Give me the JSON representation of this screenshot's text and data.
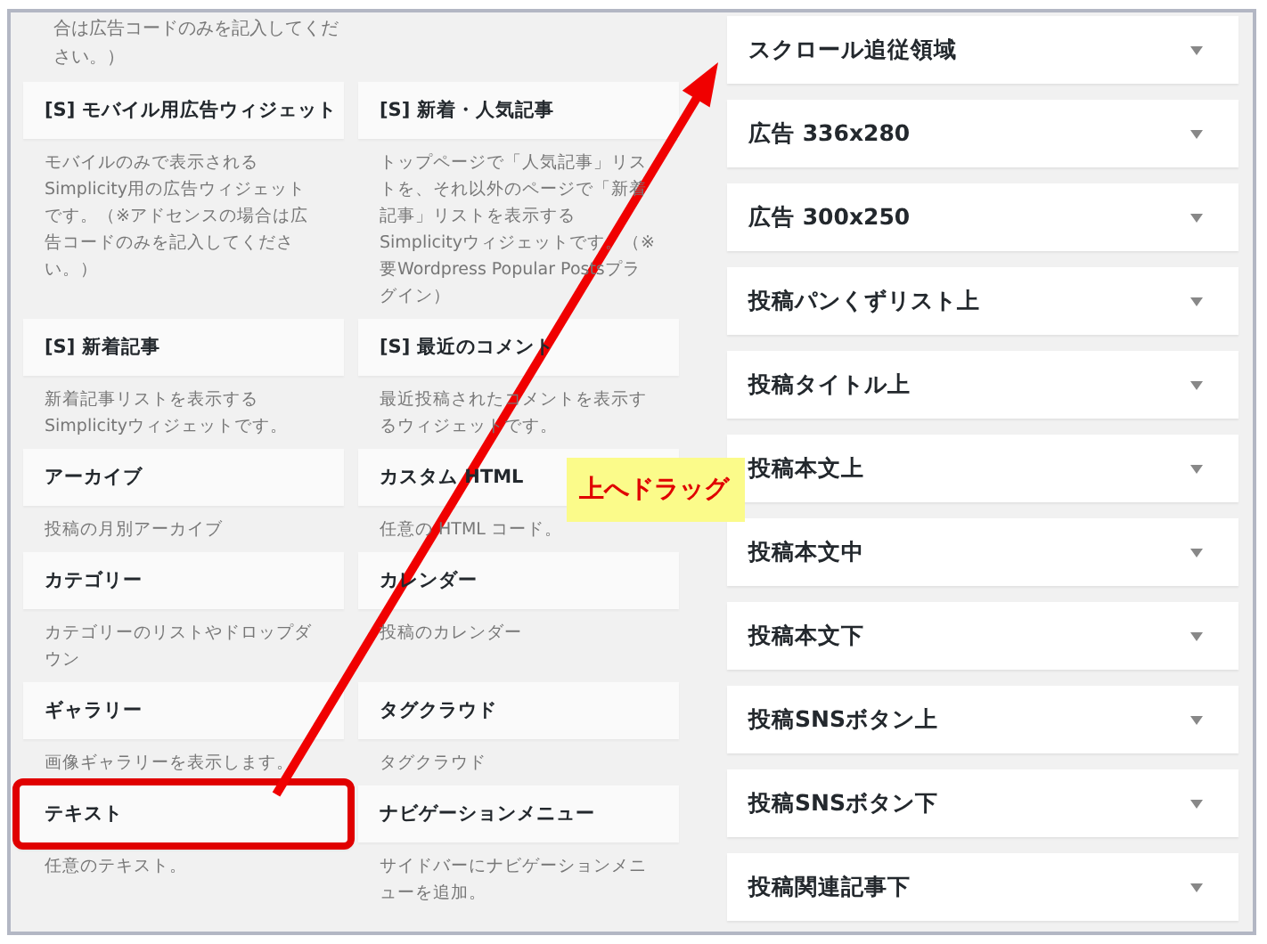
{
  "available_widgets": {
    "top_description": "合は広告コードのみを記入してください。）",
    "widgets": [
      {
        "title": "[S] モバイル用広告ウィジェット",
        "description": "モバイルのみで表示されるSimplicity用の広告ウィジェットです。（※アドセンスの場合は広告コードのみを記入してください。）",
        "highlighted": false
      },
      {
        "title": "[S] 新着・人気記事",
        "description": "トップページで「人気記事」リストを、それ以外のページで「新着記事」リストを表示するSimplicityウィジェットです。（※要Wordpress Popular Postsプラグイン）",
        "highlighted": false
      },
      {
        "title": "[S] 新着記事",
        "description": "新着記事リストを表示するSimplicityウィジェットです。",
        "highlighted": false
      },
      {
        "title": "[S] 最近のコメント",
        "description": "最近投稿されたコメントを表示するウィジェットです。",
        "highlighted": false
      },
      {
        "title": "アーカイブ",
        "description": "投稿の月別アーカイブ",
        "highlighted": false
      },
      {
        "title": "カスタム HTML",
        "description": "任意の HTML コード。",
        "highlighted": false
      },
      {
        "title": "カテゴリー",
        "description": "カテゴリーのリストやドロップダウン",
        "highlighted": false
      },
      {
        "title": "カレンダー",
        "description": "投稿のカレンダー",
        "highlighted": false
      },
      {
        "title": "ギャラリー",
        "description": "画像ギャラリーを表示します。",
        "highlighted": false
      },
      {
        "title": "タグクラウド",
        "description": "タグクラウド",
        "highlighted": false
      },
      {
        "title": "テキスト",
        "description": "任意のテキスト。",
        "highlighted": true
      },
      {
        "title": "ナビゲーションメニュー",
        "description": "サイドバーにナビゲーションメニューを追加。",
        "highlighted": false
      }
    ]
  },
  "widget_areas": [
    {
      "name": "スクロール追従領域",
      "expanded": false
    },
    {
      "name": "広告 336x280",
      "expanded": false
    },
    {
      "name": "広告 300x250",
      "expanded": false
    },
    {
      "name": "投稿パンくずリスト上",
      "expanded": false
    },
    {
      "name": "投稿タイトル上",
      "expanded": false
    },
    {
      "name": "投稿本文上",
      "expanded": false
    },
    {
      "name": "投稿本文中",
      "expanded": false
    },
    {
      "name": "投稿本文下",
      "expanded": false
    },
    {
      "name": "投稿SNSボタン上",
      "expanded": false
    },
    {
      "name": "投稿SNSボタン下",
      "expanded": false
    },
    {
      "name": "投稿関連記事下",
      "expanded": false
    }
  ],
  "annotation": {
    "label": "上へドラッグ"
  }
}
